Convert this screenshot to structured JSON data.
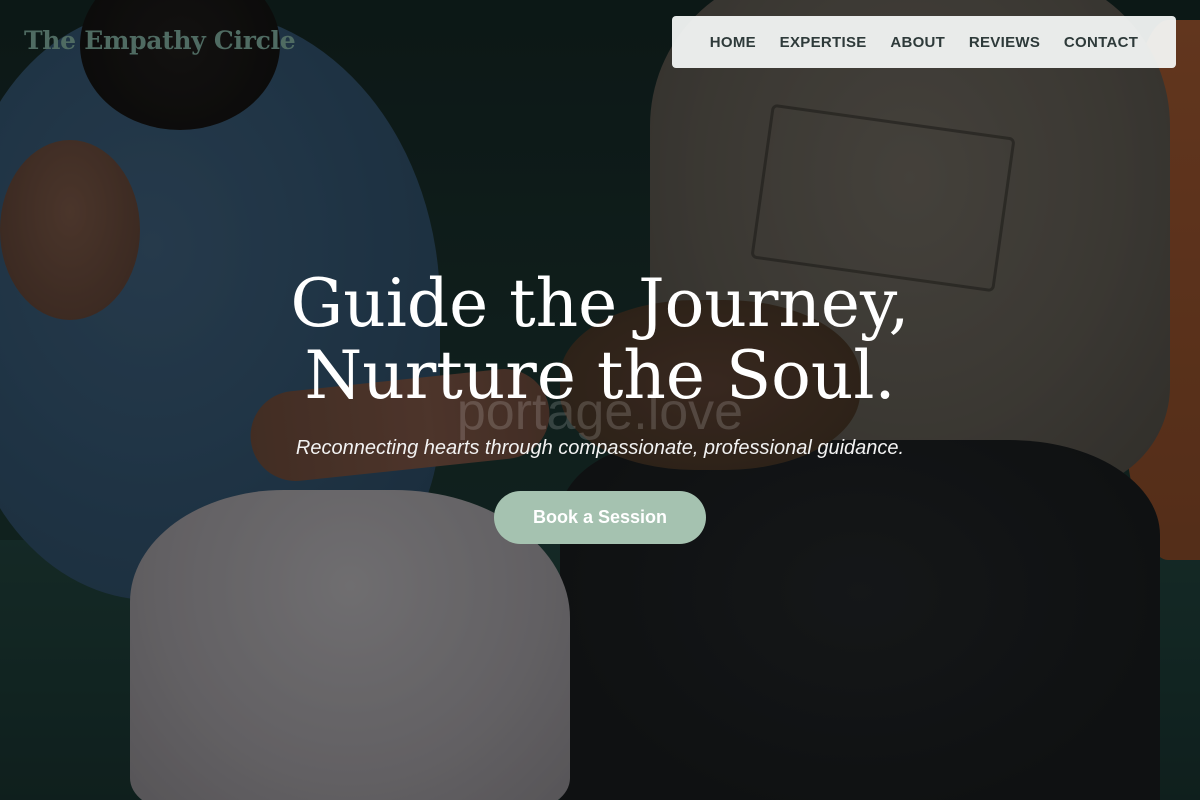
{
  "brand": {
    "name": "The Empathy Circle"
  },
  "nav": {
    "items": [
      {
        "label": "HOME"
      },
      {
        "label": "EXPERTISE"
      },
      {
        "label": "ABOUT"
      },
      {
        "label": "REVIEWS"
      },
      {
        "label": "CONTACT"
      }
    ]
  },
  "hero": {
    "title_line1": "Guide the Journey,",
    "title_line2": "Nurture the Soul.",
    "watermark": "portage.love",
    "subtitle": "Reconnecting hearts through compassionate, professional guidance.",
    "cta_label": "Book a Session",
    "background_image": "couple-holding-hands-on-sofa"
  },
  "colors": {
    "brand_text": "#4f6b62",
    "cta_background": "#a5c2b0",
    "nav_background": "#f4f6f5",
    "nav_text": "#2e3a3a"
  }
}
